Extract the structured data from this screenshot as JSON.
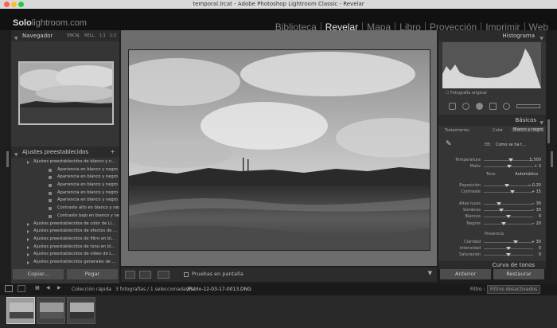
{
  "window": {
    "title": "temporal.lrcat - Adobe Photoshop Lightroom Classic - Revelar"
  },
  "logo": {
    "text1": "Solo",
    "text2": "lightroom.com"
  },
  "modules": [
    "Biblioteca",
    "Revelar",
    "Mapa",
    "Libro",
    "Proyección",
    "Imprimir",
    "Web"
  ],
  "active_module": "Revelar",
  "left_panel": {
    "navigator": {
      "title": "Navegador",
      "zoom": [
        "ENCAJ.",
        "RELL.",
        "1:1",
        "1:2"
      ]
    },
    "presets": {
      "title": "Ajustes preestablecidos",
      "items": [
        {
          "type": "group",
          "label": "Ajustes preestablecidos de blanco y n..."
        },
        {
          "type": "child",
          "label": "Apariencia en blanco y negro 1"
        },
        {
          "type": "child",
          "label": "Apariencia en blanco y negro 2"
        },
        {
          "type": "child",
          "label": "Apariencia en blanco y negro 3"
        },
        {
          "type": "child",
          "label": "Apariencia en blanco y negro 4"
        },
        {
          "type": "child",
          "label": "Apariencia en blanco y negro 5"
        },
        {
          "type": "child",
          "label": "Contraste alto en blanco y negro"
        },
        {
          "type": "child",
          "label": "Contraste bajo en blanco y negro"
        },
        {
          "type": "group",
          "label": "Ajustes preestablecidos de color de Li..."
        },
        {
          "type": "group",
          "label": "Ajustes preestablecidos de efectos de ..."
        },
        {
          "type": "group",
          "label": "Ajustes preestablecidos de filtro en bl..."
        },
        {
          "type": "group",
          "label": "Ajustes preestablecidos de tono en bl..."
        },
        {
          "type": "group",
          "label": "Ajustes preestablecidos de video de L..."
        },
        {
          "type": "group",
          "label": "Ajustes preestablecidos generales de ..."
        }
      ]
    },
    "buttons": {
      "copy": "Copiar...",
      "paste": "Pegar"
    }
  },
  "toolbar": {
    "soft_proof": "Pruebas en pantalla"
  },
  "right_panel": {
    "histogram": {
      "title": "Histograma",
      "iso": "ISO 100",
      "focal": "24 mm",
      "aperture": "f / 6,3",
      "shutter": "1⁄₁₀₀ MB",
      "original": "Fotografía original"
    },
    "basics": {
      "title": "Básicos",
      "treatment_label": "Tratamiento:",
      "color": "Color",
      "bw": "Blanco y negro",
      "wb_label": "EB:",
      "wb_value": "Como se ha t...",
      "tone_label": "Tono",
      "auto": "Automático",
      "presence_label": "Presencia",
      "next_panel": "Curva de tonos"
    },
    "sliders": [
      {
        "label": "Temperatura",
        "value": "5.500",
        "pos": 0.55
      },
      {
        "label": "Matiz",
        "value": "+ 3",
        "pos": 0.52
      },
      {
        "label": "Exposición",
        "value": "− 0,20",
        "pos": 0.47
      },
      {
        "label": "Contraste",
        "value": "+ 15",
        "pos": 0.58
      },
      {
        "label": "Altas luces",
        "value": "− 39",
        "pos": 0.3
      },
      {
        "label": "Sombras",
        "value": "− 30",
        "pos": 0.35
      },
      {
        "label": "Blancos",
        "value": "0",
        "pos": 0.5
      },
      {
        "label": "Negros",
        "value": "− 20",
        "pos": 0.4
      },
      {
        "label": "Claridad",
        "value": "+ 30",
        "pos": 0.65
      },
      {
        "label": "Intensidad",
        "value": "0",
        "pos": 0.5
      },
      {
        "label": "Saturación",
        "value": "0",
        "pos": 0.5
      }
    ],
    "buttons": {
      "previous": "Anterior",
      "restore": "Restaurar"
    }
  },
  "filmstrip_bar": {
    "collection": "Colección rápida",
    "count": "3 fotografías / 1 seleccionada(s)",
    "file": "/Pablo-12-03-17-0013.DNG",
    "filter_label": "Filtro :",
    "filter_value": "Filtros desactivados"
  },
  "colors": {
    "accent": "#e6e6e6",
    "panel": "#353535",
    "background": "#1e1e1e"
  }
}
